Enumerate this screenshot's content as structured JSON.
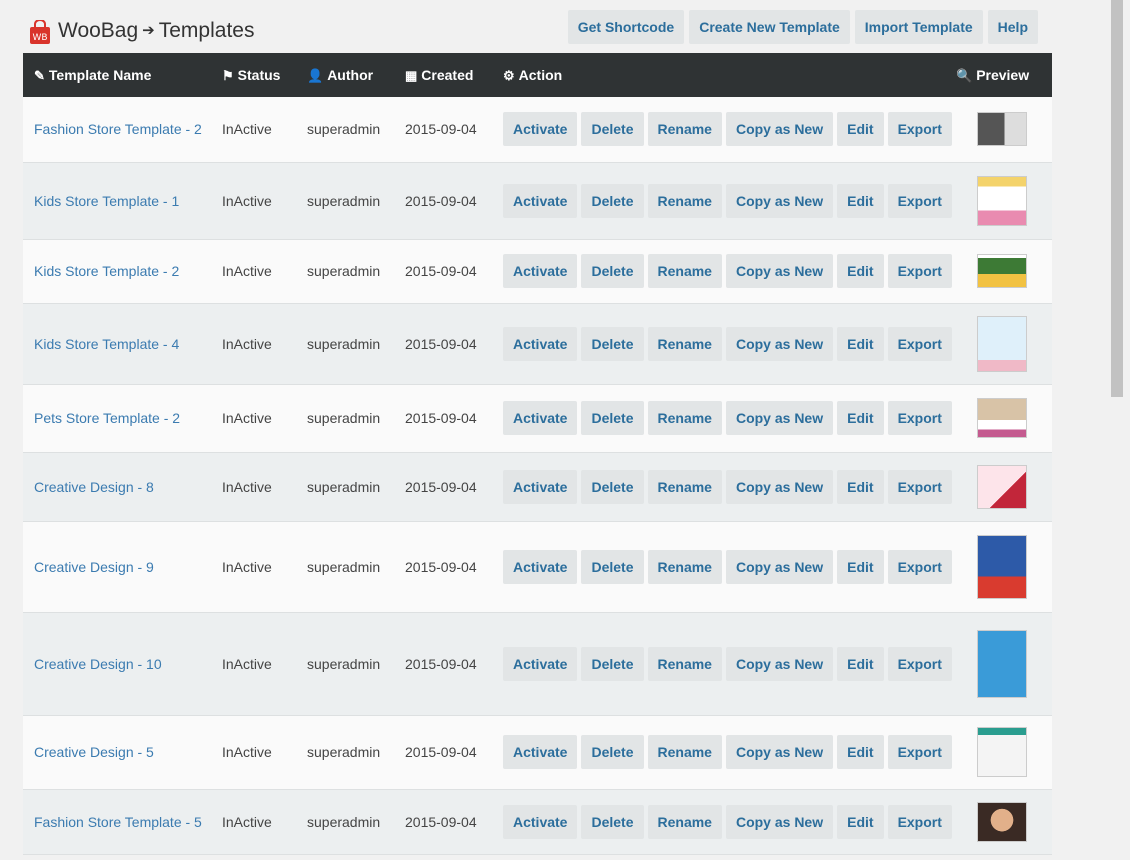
{
  "app": {
    "name": "WooBag",
    "arrow": "➔",
    "page": "Templates"
  },
  "toolbar": [
    "Get Shortcode",
    "Create New Template",
    "Import Template",
    "Help"
  ],
  "columns": {
    "name": "Template Name",
    "status": "Status",
    "author": "Author",
    "created": "Created",
    "action": "Action",
    "preview": "Preview"
  },
  "action_labels": [
    "Activate",
    "Delete",
    "Rename",
    "Copy as New",
    "Edit",
    "Export"
  ],
  "rows": [
    {
      "name": "Fashion Store Template - 2",
      "status": "InActive",
      "author": "superadmin",
      "created": "2015-09-04",
      "preview": "fashion-dark"
    },
    {
      "name": "Kids Store Template - 1",
      "status": "InActive",
      "author": "superadmin",
      "created": "2015-09-04",
      "preview": "kids-colorful"
    },
    {
      "name": "Kids Store Template - 2",
      "status": "InActive",
      "author": "superadmin",
      "created": "2015-09-04",
      "preview": "kids-chalkboard"
    },
    {
      "name": "Kids Store Template - 4",
      "status": "InActive",
      "author": "superadmin",
      "created": "2015-09-04",
      "preview": "kids-lightblue"
    },
    {
      "name": "Pets Store Template - 2",
      "status": "InActive",
      "author": "superadmin",
      "created": "2015-09-04",
      "preview": "pets-brown"
    },
    {
      "name": "Creative Design - 8",
      "status": "InActive",
      "author": "superadmin",
      "created": "2015-09-04",
      "preview": "creative-pink"
    },
    {
      "name": "Creative Design - 9",
      "status": "InActive",
      "author": "superadmin",
      "created": "2015-09-04",
      "preview": "creative-blue-gifts"
    },
    {
      "name": "Creative Design - 10",
      "status": "InActive",
      "author": "superadmin",
      "created": "2015-09-04",
      "preview": "creative-sky-blue"
    },
    {
      "name": "Creative Design - 5",
      "status": "InActive",
      "author": "superadmin",
      "created": "2015-09-04",
      "preview": "creative-teal"
    },
    {
      "name": "Fashion Store Template - 5",
      "status": "InActive",
      "author": "superadmin",
      "created": "2015-09-04",
      "preview": "fashion-portrait"
    }
  ],
  "colors": {
    "header_bg": "#2f3334",
    "link": "#3b7bb0",
    "button_bg": "#e2e5e6",
    "button_text": "#2c6e9c",
    "brand_red": "#d9342b"
  }
}
